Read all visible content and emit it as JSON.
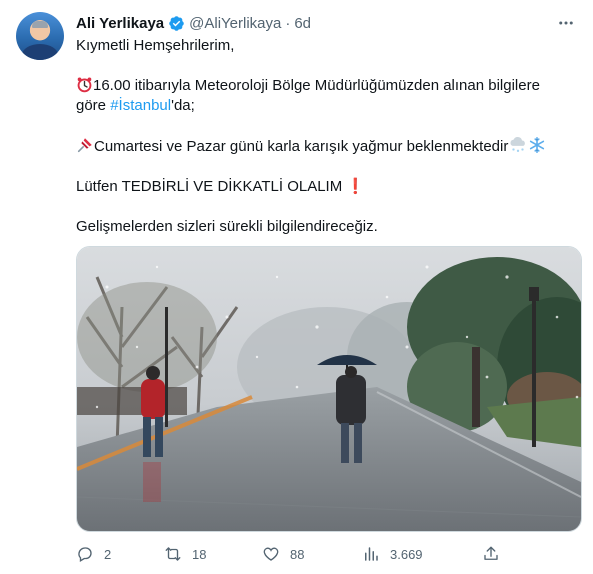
{
  "tweet": {
    "author_name": "Ali Yerlikaya",
    "handle": "@AliYerlikaya",
    "separator": "·",
    "time": "6d",
    "lines": {
      "l1": "Kıymetli Hemşehrilerim,",
      "l2a": "16.00 itibarıyla Meteoroloji Bölge Müdürlüğümüzden alınan bilgilere",
      "l2b_pre": "göre ",
      "hashtag": "#İstanbul",
      "l2b_post": "'da;",
      "l3": "Cumartesi ve Pazar günü karla karışık yağmur  beklenmektedir",
      "l4": "Lütfen TEDBİRLİ VE DİKKATLİ OLALIM",
      "l5": "Gelişmelerden sizleri sürekli bilgilendireceğiz."
    },
    "stats": {
      "replies": "2",
      "retweets": "18",
      "likes": "88",
      "views": "3.669"
    }
  },
  "colors": {
    "link": "#1d9bf0",
    "verified": "#1d9bf0",
    "secondary": "#536471",
    "exclamation": "#d7262b"
  },
  "icons": {
    "more": "more-dots-icon",
    "reply": "reply-icon",
    "retweet": "retweet-icon",
    "like": "heart-icon",
    "views": "views-chart-icon",
    "share": "share-icon",
    "clock": "alarm-clock-emoji",
    "pin": "pushpin-emoji",
    "cloud": "cloud-with-snow-emoji",
    "snowflake": "snowflake-emoji",
    "exclamation": "red-exclamation-emoji"
  }
}
